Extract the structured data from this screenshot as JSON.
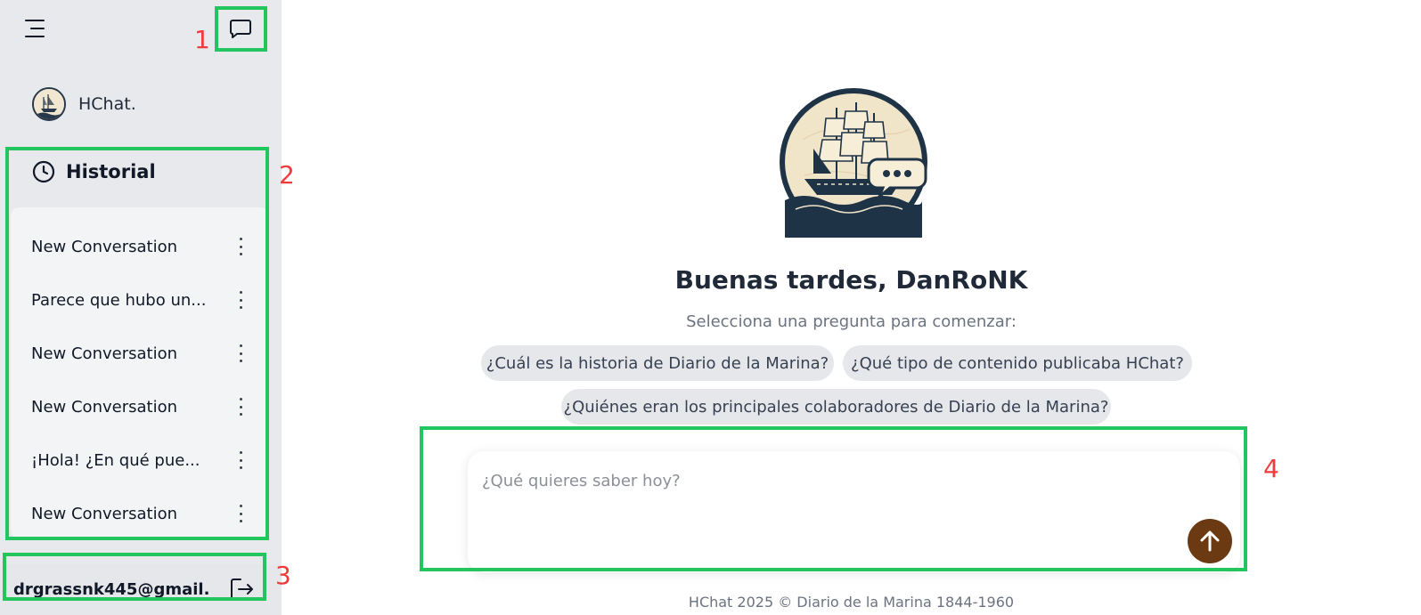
{
  "sidebar": {
    "brand_name": "HChat.",
    "history_title": "Historial",
    "conversations": [
      {
        "label": "New Conversation"
      },
      {
        "label": "Parece que hubo un..."
      },
      {
        "label": "New Conversation"
      },
      {
        "label": "New Conversation"
      },
      {
        "label": "¡Hola! ¿En qué pue..."
      },
      {
        "label": "New Conversation"
      }
    ],
    "user_email": "drgrassnk445@gmail...."
  },
  "main": {
    "greeting": "Buenas tardes, DanRoNK",
    "subtitle": "Selecciona una pregunta para comenzar:",
    "suggestions": [
      "¿Cuál es la historia de Diario de la Marina?",
      "¿Qué tipo de contenido publicaba HChat?",
      "¿Quiénes eran los principales colaboradores de Diario de la Marina?"
    ],
    "input_placeholder": "¿Qué quieres saber hoy?",
    "footer": "HChat 2025 © Diario de la Marina 1844-1960"
  },
  "annotations": {
    "labels": [
      "1",
      "2",
      "3",
      "4"
    ]
  },
  "colors": {
    "annotation_box": "#22c55e",
    "annotation_label": "#ef3b3b",
    "send_button": "#6b3a12",
    "sidebar_bg": "#e8e9ec"
  },
  "icons": [
    "menu-icon",
    "chat-bubble-icon",
    "clock-icon",
    "more-vertical-icon",
    "logout-icon",
    "arrow-up-icon",
    "ship-logo"
  ]
}
